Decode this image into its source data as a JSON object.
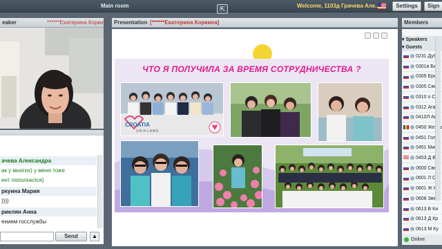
{
  "topbar": {
    "room_title": "Main room",
    "welcome": "Welcome, 1103д Грачева Але...",
    "settings_label": "Settings",
    "signout_label": "Sign"
  },
  "speaker_panel": {
    "header": "eaker",
    "speaker_name": "******Екатерина Коркина"
  },
  "presentation": {
    "header": "Presentation",
    "presenter": "[******Екатерина Коркина]",
    "slide_title": "ЧТО Я ПОЛУЧИЛА ЗА ВРЕМЯ СОТРУДНИЧЕСТВА ?",
    "banner_text": "CROATIA",
    "brand_text": "ORIFLAME"
  },
  "chat": {
    "messages": [
      {
        "text": "ачева Александра",
        "type": "name"
      },
      {
        "text": "ак у многих) у меня тоже",
        "type": "msg"
      },
      {
        "text": "ент пополнился)",
        "type": "msg"
      },
      {
        "text": "ркуина Мария",
        "type": "name"
      },
      {
        "text": "))))",
        "type": "msg"
      },
      {
        "text": "риелян Анна",
        "type": "name"
      },
      {
        "text": "ением госслужбы",
        "type": "msg"
      }
    ],
    "send_label": "Send"
  },
  "members": {
    "header": "Members",
    "speakers_label": "Speakers",
    "guests_label": "Guests",
    "list": [
      "0231 Дуб",
      "0301в Беб",
      "0305 Ериі",
      "0305 Свет",
      "0310 о Сві",
      "0312 Агафі",
      "0410Л Ани",
      "0450 Жераа",
      "0451 Голо",
      "0451 Мин",
      "0453 Д Ва",
      "0600 Свет",
      "0601 Л Сн",
      "0601 Ж Ка",
      "0608 Звет",
      "0613 В Ки",
      "0613 Д Кр",
      "0613 М Ку"
    ],
    "status": "Online"
  },
  "colors": {
    "accent": "#e0188c",
    "topbar": "#3b4750",
    "presenter": "#c0392b"
  }
}
